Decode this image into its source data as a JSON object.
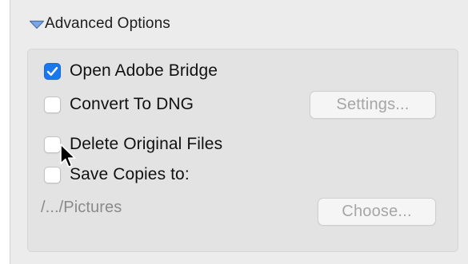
{
  "section": {
    "title": "Advanced Options",
    "expanded": true
  },
  "options": {
    "open_bridge": {
      "label": "Open Adobe Bridge",
      "checked": true
    },
    "convert_dng": {
      "label": "Convert To DNG",
      "checked": false
    },
    "delete_originals": {
      "label": "Delete Original Files",
      "checked": false
    },
    "save_copies": {
      "label": "Save Copies to:",
      "checked": false
    }
  },
  "buttons": {
    "settings_label": "Settings...",
    "choose_label": "Choose..."
  },
  "save_path": "/.../Pictures",
  "colors": {
    "accent": "#1a78ee",
    "disabled_text": "#a6a6a6",
    "panel_bg": "#ececec",
    "group_bg": "#e3e3e3"
  },
  "icons": {
    "disclosure": "disclosure-triangle-down-icon",
    "check": "checkmark-icon",
    "cursor": "arrow-pointer-icon"
  }
}
